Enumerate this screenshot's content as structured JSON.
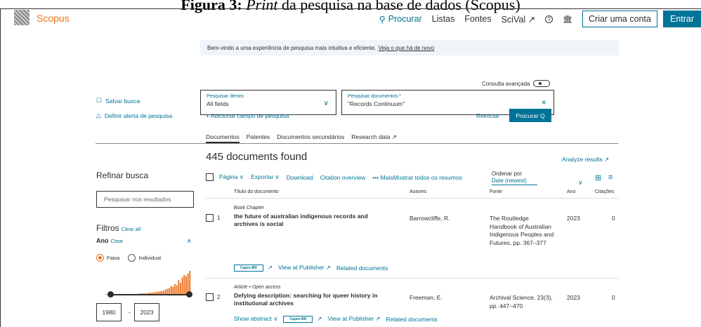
{
  "caption": {
    "bold": "Figura 3:",
    "italic": "Print",
    "rest": "da pesquisa na base de dados (Scopus)"
  },
  "header": {
    "brand": "Scopus",
    "nav": {
      "search": "Procurar",
      "lists": "Listas",
      "sources": "Fontes",
      "scival": "SciVal ↗",
      "help_icon": "?",
      "institution_icon": "🏛",
      "create_account": "Criar uma conta",
      "login": "Entrar"
    }
  },
  "banner": {
    "text": "Bem-vindo a uma experiência de pesquisa mais intuitiva e eficiente.",
    "link": "Veja o que há de novo"
  },
  "advanced_search": "Consulta avançada",
  "search": {
    "within_label": "Pesquisar dentro",
    "within_value": "All fields",
    "docs_label": "Pesquisar documentos *",
    "docs_value": "\"Records Continuum\"",
    "add_field": "+ Adicionar campo de pesquisa",
    "reset": "Reiniciar",
    "submit": "Procurar Q"
  },
  "left_links": {
    "save": "Salvar busca",
    "alert": "Definir alerta de pesquisa"
  },
  "tabs": [
    "Documentos",
    "Patentes",
    "Documentos secundários",
    "Research data ↗"
  ],
  "results": {
    "found": "445 documents found",
    "analyze": "Analyze results ↗",
    "toolbar": {
      "page": "Página ∨",
      "export": "Exportar ∨",
      "download": "Download",
      "citation": "Citation overview",
      "more": "••• Mais",
      "show_all": "Mostrar todos os resumos"
    },
    "sort": {
      "label": "Ordenar por",
      "value": "Date (newest)"
    },
    "columns": {
      "title": "Título do documento",
      "authors": "Autores",
      "source": "Fonte",
      "year": "Ano",
      "citations": "Citações"
    },
    "rows": [
      {
        "num": "1",
        "type": "Book Chapter",
        "title": "the future of australian indigenous records and archives is social",
        "authors": "Barrowcliffe, R.",
        "source": "The Routledge Handbook of Australian Indigenous Peoples and Futures, pp. 367–377",
        "year": "2023",
        "citations": "0",
        "capes": "Capes-BR",
        "publisher": "View at Publisher ↗",
        "related": "Related documents"
      },
      {
        "num": "2",
        "type": "Article • Open access",
        "title": "Defying description: searching for queer history in institutional archives",
        "authors": "Freeman, E.",
        "source": "Archival Science, 23(3), pp. 447–470",
        "year": "2023",
        "citations": "0",
        "show_abstract": "Show abstract ∨",
        "capes": "Capes-BR",
        "publisher": "View at Publisher ↗",
        "related": "Related documents"
      }
    ]
  },
  "refine": {
    "title": "Refinar busca",
    "placeholder": "Pesquisar nos resultados",
    "filters": "Filtros",
    "clear_all": "Clear all",
    "year_label": "Ano",
    "year_clear": "Clear",
    "range": "Faixa",
    "individual": "Individual",
    "year_from": "1980",
    "year_to": "2023",
    "histogram": [
      1,
      1,
      1,
      1,
      1,
      1,
      1,
      1,
      1,
      1,
      1,
      1,
      1,
      1,
      1,
      1,
      1,
      1,
      2,
      2,
      2,
      2,
      2,
      3,
      3,
      3,
      4,
      4,
      5,
      5,
      6,
      6,
      8,
      9,
      10,
      13,
      12,
      16,
      14,
      22,
      18,
      26,
      30,
      28,
      32,
      36
    ]
  }
}
